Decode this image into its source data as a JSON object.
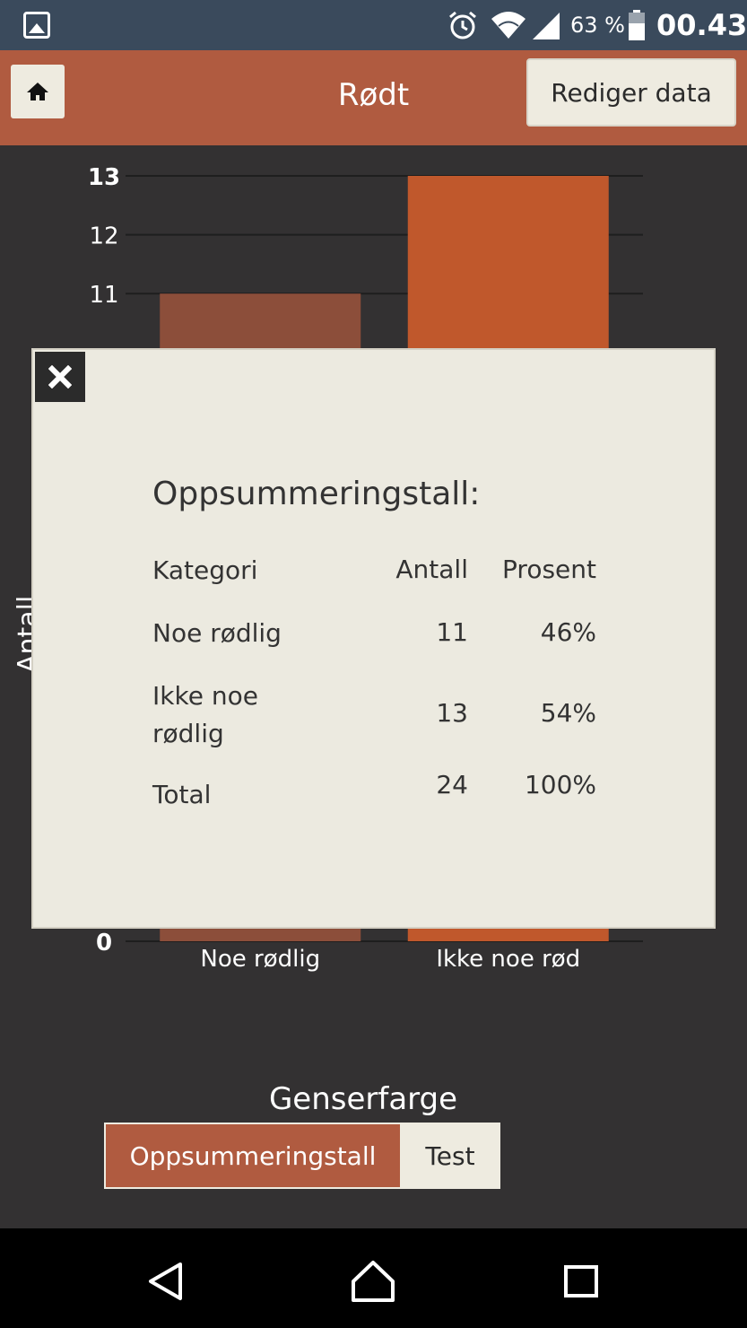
{
  "status_bar": {
    "battery_percent": "63 %",
    "time": "00.43",
    "icons": [
      "gallery-icon",
      "alarm-icon",
      "wifi-icon",
      "signal-icon",
      "battery-icon"
    ]
  },
  "app_bar": {
    "title": "Rødt",
    "edit_label": "Rediger data",
    "home_icon": "home-icon"
  },
  "chart_data": {
    "type": "bar",
    "categories": [
      "Noe rødlig",
      "Ikke noe rød"
    ],
    "values": [
      11,
      13
    ],
    "colors": [
      "#8c4e3a",
      "#c0582c"
    ],
    "xlabel": "Genserfarge",
    "ylabel": "Antall",
    "ylim": [
      0,
      13
    ],
    "visible_ticks": [
      13,
      12,
      11,
      0
    ],
    "grid": true
  },
  "modal": {
    "title": "Oppsummeringstall:",
    "close_icon": "close-icon",
    "headers": {
      "category": "Kategori",
      "count": "Antall",
      "percent": "Prosent"
    },
    "rows": [
      {
        "category": "Noe rødlig",
        "count": "11",
        "percent": "46%"
      },
      {
        "category": "Ikke noe rødlig",
        "count": "13",
        "percent": "54%"
      },
      {
        "category": "Total",
        "count": "24",
        "percent": "100%"
      }
    ]
  },
  "tabs": [
    {
      "label": "Oppsummeringstall",
      "active": true
    },
    {
      "label": "Test",
      "active": false
    }
  ],
  "nav_bar": {
    "icons": [
      "back-icon",
      "home-nav-icon",
      "recents-icon"
    ]
  }
}
